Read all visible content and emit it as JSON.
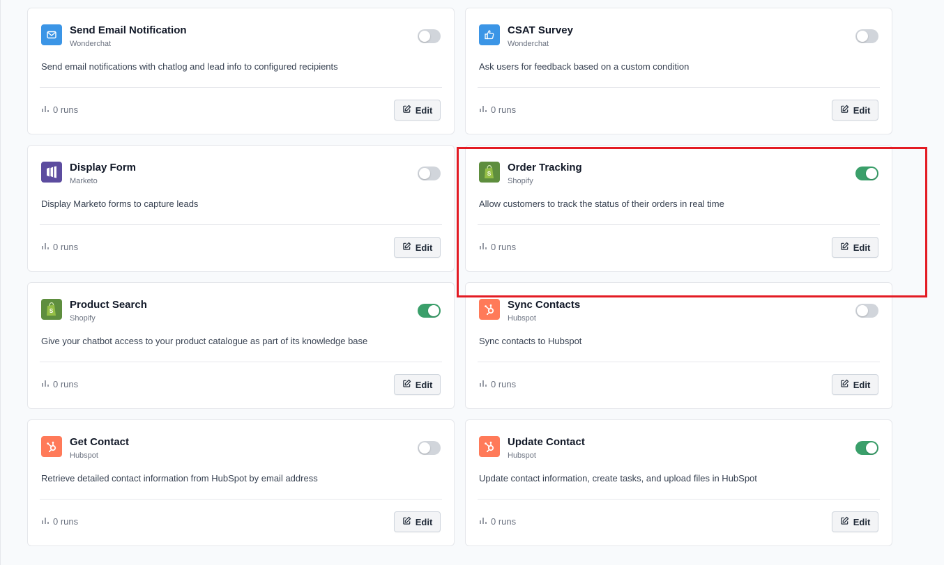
{
  "cards": [
    {
      "title": "",
      "provider": "",
      "description": "",
      "runs": "",
      "edit": "",
      "enabled": false,
      "icon": "",
      "icon_bg": "#ffffff"
    },
    {
      "title": "",
      "provider": "",
      "description": "",
      "runs": "",
      "edit": "",
      "enabled": false,
      "icon": "",
      "icon_bg": "#ffffff"
    },
    {
      "title": "Send Email Notification",
      "provider": "Wonderchat",
      "description": "Send email notifications with chatlog and lead info to configured recipients",
      "runs": "0 runs",
      "edit": "Edit",
      "enabled": false,
      "icon": "mail-icon",
      "icon_bg": "#3b95e6"
    },
    {
      "title": "CSAT Survey",
      "provider": "Wonderchat",
      "description": "Ask users for feedback based on a custom condition",
      "runs": "0 runs",
      "edit": "Edit",
      "enabled": false,
      "icon": "thumbs-up-icon",
      "icon_bg": "#3b95e6"
    },
    {
      "title": "Display Form",
      "provider": "Marketo",
      "description": "Display Marketo forms to capture leads",
      "runs": "0 runs",
      "edit": "Edit",
      "enabled": false,
      "icon": "marketo-icon",
      "icon_bg": "#5c4c9f"
    },
    {
      "title": "Order Tracking",
      "provider": "Shopify",
      "description": "Allow customers to track the status of their orders in real time",
      "runs": "0 runs",
      "edit": "Edit",
      "enabled": true,
      "icon": "shopify-icon",
      "icon_bg": "#5e8e3e"
    },
    {
      "title": "Product Search",
      "provider": "Shopify",
      "description": "Give your chatbot access to your product catalogue as part of its knowledge base",
      "runs": "0 runs",
      "edit": "Edit",
      "enabled": true,
      "icon": "shopify-icon",
      "icon_bg": "#5e8e3e"
    },
    {
      "title": "Sync Contacts",
      "provider": "Hubspot",
      "description": "Sync contacts to Hubspot",
      "runs": "0 runs",
      "edit": "Edit",
      "enabled": false,
      "icon": "hubspot-icon",
      "icon_bg": "#ff7a59"
    },
    {
      "title": "Get Contact",
      "provider": "Hubspot",
      "description": "Retrieve detailed contact information from HubSpot by email address",
      "runs": "0 runs",
      "edit": "Edit",
      "enabled": false,
      "icon": "hubspot-icon",
      "icon_bg": "#ff7a59"
    },
    {
      "title": "Update Contact",
      "provider": "Hubspot",
      "description": "Update contact information, create tasks, and upload files in HubSpot",
      "runs": "0 runs",
      "edit": "Edit",
      "enabled": true,
      "icon": "hubspot-icon",
      "icon_bg": "#ff7a59"
    }
  ],
  "colors": {
    "toggle_on": "#3a9f6a",
    "toggle_off": "#d1d5db",
    "highlight_border": "#e31b23"
  }
}
